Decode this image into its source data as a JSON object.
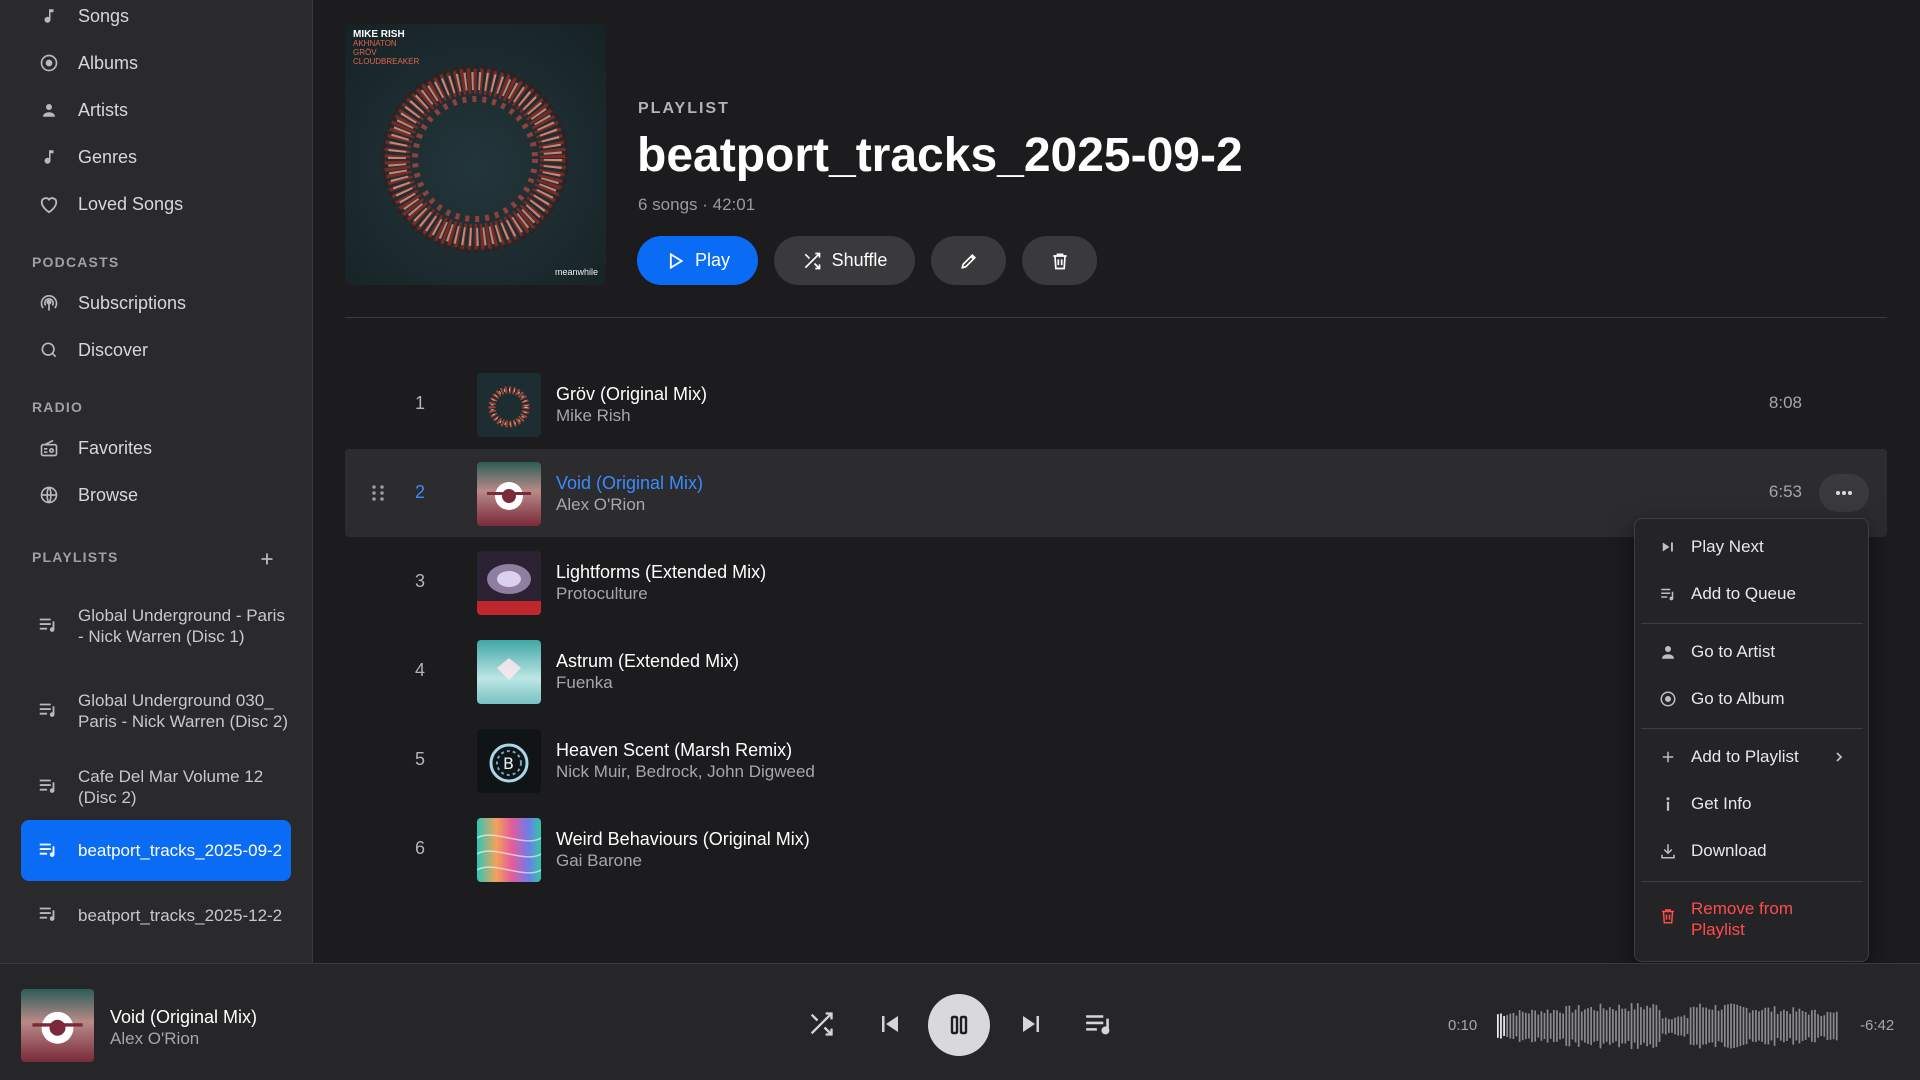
{
  "sidebar": {
    "library": [
      {
        "label": "Songs",
        "icon": "music-note-icon"
      },
      {
        "label": "Albums",
        "icon": "album-disc-icon"
      },
      {
        "label": "Artists",
        "icon": "person-icon"
      },
      {
        "label": "Genres",
        "icon": "music-note-icon"
      },
      {
        "label": "Loved Songs",
        "icon": "heart-icon"
      }
    ],
    "podcasts_title": "PODCASTS",
    "podcasts": [
      {
        "label": "Subscriptions",
        "icon": "podcast-icon"
      },
      {
        "label": "Discover",
        "icon": "search-icon"
      }
    ],
    "radio_title": "RADIO",
    "radio": [
      {
        "label": "Favorites",
        "icon": "radio-icon"
      },
      {
        "label": "Browse",
        "icon": "globe-icon"
      }
    ],
    "playlists_title": "PLAYLISTS",
    "playlists": [
      {
        "label": "Global Underground - Paris - Nick Warren (Disc 1)"
      },
      {
        "label": "Global Underground 030_ Paris - Nick Warren (Disc 2)"
      },
      {
        "label": "Cafe Del Mar Volume 12 (Disc 2)"
      },
      {
        "label": "beatport_tracks_2025-09-2",
        "active": true
      },
      {
        "label": "beatport_tracks_2025-12-2"
      }
    ]
  },
  "header": {
    "kicker": "PLAYLIST",
    "title": "beatport_tracks_2025-09-2",
    "meta": "6 songs · 42:01",
    "play_label": "Play",
    "shuffle_label": "Shuffle",
    "cover": {
      "artist": "MIKE RISH",
      "tracks": [
        "AKHNATON",
        "GRÖV",
        "CLOUDBREAKER"
      ],
      "label": "meanwhile"
    }
  },
  "tracks": [
    {
      "num": "1",
      "title": "Gröv (Original Mix)",
      "artist": "Mike Rish",
      "duration": "8:08"
    },
    {
      "num": "2",
      "title": "Void (Original Mix)",
      "artist": "Alex O'Rion",
      "duration": "6:53",
      "active": true
    },
    {
      "num": "3",
      "title": "Lightforms (Extended Mix)",
      "artist": "Protoculture",
      "duration": ""
    },
    {
      "num": "4",
      "title": "Astrum (Extended Mix)",
      "artist": "Fuenka",
      "duration": ""
    },
    {
      "num": "5",
      "title": "Heaven Scent (Marsh Remix)",
      "artist": "Nick Muir, Bedrock, John Digweed",
      "duration": ""
    },
    {
      "num": "6",
      "title": "Weird Behaviours (Original Mix)",
      "artist": "Gai Barone",
      "duration": ""
    }
  ],
  "context_menu": {
    "play_next": "Play Next",
    "add_to_queue": "Add to Queue",
    "go_to_artist": "Go to Artist",
    "go_to_album": "Go to Album",
    "add_to_playlist": "Add to Playlist",
    "get_info": "Get Info",
    "download": "Download",
    "remove_from_playlist": "Remove from Playlist"
  },
  "player": {
    "title": "Void (Original Mix)",
    "artist": "Alex O'Rion",
    "elapsed": "0:10",
    "remaining": "-6:42",
    "progress": 0.025
  },
  "colors": {
    "accent": "#0a6cf5",
    "active_text": "#3a8bff",
    "danger": "#ff4b4b",
    "background": "#1c1c1e",
    "sidebar": "#2a2a2c"
  }
}
